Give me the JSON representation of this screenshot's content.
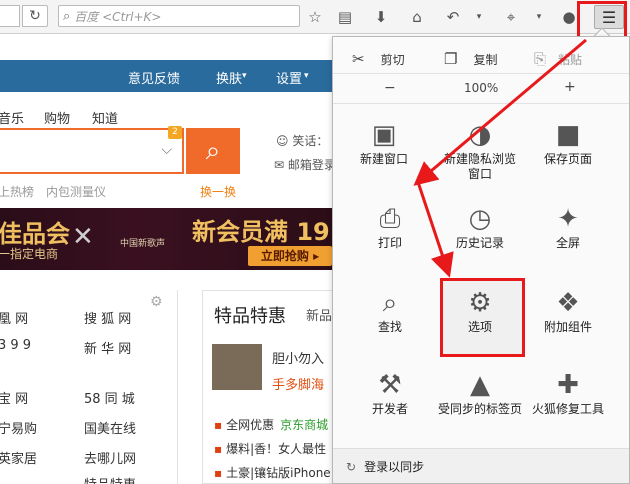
{
  "toolbar": {
    "search_placeholder": "百度 <Ctrl+K>"
  },
  "page": {
    "nav": [
      "意见反馈",
      "换肤",
      "设置"
    ],
    "categories": [
      "音乐",
      "购物",
      "知道"
    ],
    "search_badge": "2",
    "joke_label": "笑话：",
    "mail_label": "邮箱登录",
    "hot_links": [
      "上热榜",
      "内包测量仪"
    ],
    "swap_label": "换一换",
    "banner": {
      "left_title": "佳品会",
      "left_sub": "一指定电商",
      "right_title": "新会员满 19",
      "china_text": "中国新歌声",
      "button": "立即抢购 ▸"
    },
    "sites": [
      [
        "凰 网",
        "搜 狐 网"
      ],
      [
        "3 9 9",
        "新 华 网"
      ],
      [
        "宝 网",
        "58 同 城"
      ],
      [
        "宁易购",
        "国美在线"
      ],
      [
        "英家居",
        "去哪儿网"
      ],
      [
        "",
        "特品特惠"
      ]
    ],
    "special": {
      "title": "特品特惠",
      "subtitle": "新品",
      "headline": "胆小勿入",
      "headline2": "手多脚海",
      "items": [
        {
          "tag": "全网优惠",
          "extra": "京东商城"
        },
        {
          "tag": "爆料|香！女人最性",
          "extra": ""
        },
        {
          "tag": "土豪|镶钻版iPhone",
          "extra": ""
        }
      ]
    }
  },
  "menu": {
    "cut": "剪切",
    "copy": "复制",
    "paste": "粘贴",
    "zoom_out": "−",
    "zoom_level": "100%",
    "zoom_in": "+",
    "items": [
      {
        "label": "新建窗口",
        "icon": "window-icon"
      },
      {
        "label": "新建隐私浏览窗口",
        "icon": "mask-icon"
      },
      {
        "label": "保存页面",
        "icon": "save-page-icon"
      },
      {
        "label": "打印",
        "icon": "print-icon"
      },
      {
        "label": "历史记录",
        "icon": "history-icon"
      },
      {
        "label": "全屏",
        "icon": "fullscreen-icon"
      },
      {
        "label": "查找",
        "icon": "find-icon"
      },
      {
        "label": "选项",
        "icon": "options-gear-icon"
      },
      {
        "label": "附加组件",
        "icon": "puzzle-icon"
      },
      {
        "label": "开发者",
        "icon": "wrench-icon"
      },
      {
        "label": "受同步的标签页",
        "icon": "synced-tabs-icon"
      },
      {
        "label": "火狐修复工具",
        "icon": "repair-kit-icon"
      }
    ],
    "sync": "登录以同步"
  },
  "colors": {
    "highlight": "#e8191b",
    "nav_blue": "#2a6b9e",
    "search_orange": "#f06a2a"
  }
}
